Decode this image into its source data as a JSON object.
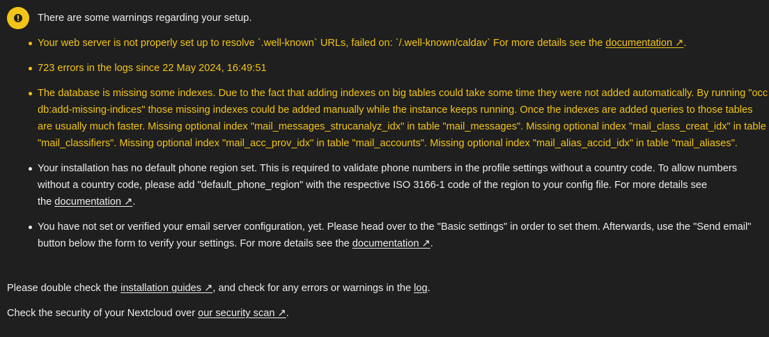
{
  "header": {
    "text": "There are some warnings regarding your setup.",
    "icon": "warning-icon",
    "icon_color": "#f2c418"
  },
  "issues": [
    {
      "level": "warning",
      "text": "Your web server is not properly set up to resolve `.well-known` URLs, failed on: `/.well-known/caldav` For more details see the",
      "link": "documentation ↗",
      "after": "."
    },
    {
      "level": "warning",
      "text": "723 errors in the logs since 22 May 2024, 16:49:51"
    },
    {
      "level": "warning",
      "text": "The database is missing some indexes. Due to the fact that adding indexes on big tables could take some time they were not added automatically. By running \"occ db:add-missing-indices\" those missing indexes could be added manually while the instance keeps running. Once the indexes are added queries to those tables are usually much faster. Missing optional index \"mail_messages_strucanalyz_idx\" in table \"mail_messages\". Missing optional index \"mail_class_creat_idx\" in table \"mail_classifiers\". Missing optional index \"mail_acc_prov_idx\" in table \"mail_accounts\". Missing optional index \"mail_alias_accid_idx\" in table \"mail_aliases\"."
    },
    {
      "level": "info",
      "text": "Your installation has no default phone region set. This is required to validate phone numbers in the profile settings without a country code. To allow numbers without a country code, please add \"default_phone_region\" with the respective ISO 3166-1 code of the region to your config file. For more details see the",
      "link": "documentation ↗",
      "after": "."
    },
    {
      "level": "info",
      "text": "You have not set or verified your email server configuration, yet. Please head over to the \"Basic settings\" in order to set them. Afterwards, use the \"Send email\" button below the form to verify your settings. For more details see the",
      "link": "documentation ↗",
      "after": "."
    }
  ],
  "footer": {
    "line1_prefix": "Please double check the ",
    "line1_link": "installation guides ↗",
    "line1_middle": ", and check for any errors or warnings in the ",
    "line1_log_link": "log",
    "line1_suffix": ".",
    "line2_prefix": "Check the security of your Nextcloud over ",
    "line2_link": "our security scan ↗",
    "line2_suffix": "."
  },
  "colors": {
    "background": "#1f1f1f",
    "warning": "#f2c418",
    "text": "#ededed"
  }
}
